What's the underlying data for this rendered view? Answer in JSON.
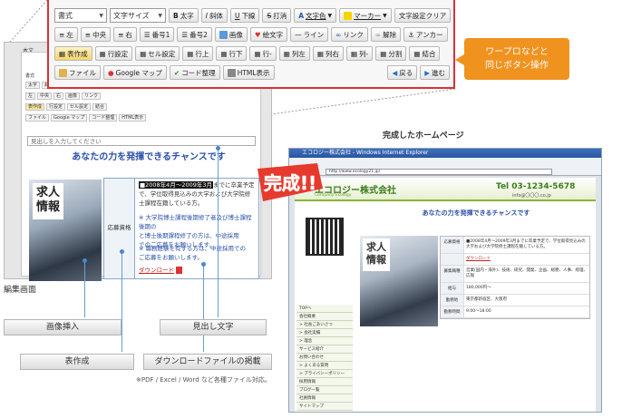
{
  "toolbar": {
    "row1": {
      "style_select": "書式",
      "fontsize_select": "文字サイズ",
      "bold": "太字",
      "italic": "斜体",
      "underline": "下線",
      "strike": "打消",
      "text_color": "文字色",
      "marker": "マーカー",
      "clear_format": "文字設定クリア"
    },
    "row2": {
      "align_left": "左",
      "align_center": "中央",
      "align_right": "右",
      "numbered": "番号1",
      "numbered2": "番号2",
      "image": "画像",
      "emoji": "絵文字",
      "line": "ライン",
      "link": "リンク",
      "unlink": "解除",
      "anchor": "アンカー"
    },
    "row3": {
      "table": "表作成",
      "row_setting": "行設定",
      "cell_setting": "セル設定",
      "row_add": "行上",
      "row_down": "行下",
      "row_del": "行-",
      "col_left": "列左",
      "col_right": "列右",
      "col_del": "列-",
      "split": "分割",
      "merge": "結合"
    },
    "row4": {
      "file": "ファイル",
      "google_map": "Google マップ",
      "code": "コード整理",
      "html": "HTML表示",
      "back": "戻る",
      "forward": "進む"
    }
  },
  "callout": {
    "line1": "ワープロなどと",
    "line2": "同じボタン操作"
  },
  "editor": {
    "tab_label": "本文",
    "tab_sub": "書式",
    "heading_input": "見出しを入力してください",
    "title": "あなたの力を発揮できるチャンスです",
    "image_text": "求人\n情報",
    "table_label": "応募資格",
    "cell_line1_hl": "■2008年4月〜2009年3月",
    "cell_line1": "までに卒業予定",
    "cell_line2": "で、学位取得見込みの大学および大学院修",
    "cell_line3": "士課程在籍している方。",
    "note1": "※ 大学院博士課程後期修了者及び博士課程後期の",
    "note1b": "と博士後期課程修了の方は、中途採用",
    "note1c": "でのご応募をお願いします。",
    "note2": "※ 職務経験を有する方は、中途採用での",
    "note2b": "ご応募をお願いします。",
    "download": "ダウンロード"
  },
  "site": {
    "caption": "完成したホームページ",
    "window_title": "エコロジー株式会社 - Windows Internet Explorer",
    "address": "http://www.ecology21.jp/",
    "company": "エコロジー株式会社",
    "company_en": "Company Ecology",
    "tel": "Tel 03-1234-5678",
    "mail": "info@〇〇〇.co.jp",
    "title": "あなたの力を発揮できるチャンスです",
    "image_text": "求人\n情報",
    "nav": [
      "TOPへ",
      "会社概要",
      "> 社長ごあいさつ",
      "> 会社実績",
      "> 理念",
      "サービス紹介",
      "お問い合わせ",
      "> よくある質問",
      "> プライバシーポリシー",
      "採用情報",
      "ブログ一覧",
      "社員情報",
      "サイトマップ"
    ],
    "rows": [
      {
        "k": "応募資格",
        "v": "■2008年4月〜2009年3月までに卒業予定で、学位取得見込みの大学および大学院修士課程在籍している方。"
      },
      {
        "k": "",
        "v": "ダウンロード"
      },
      {
        "k": "募集職種",
        "v": "営業(国内・海外)、技術、研究、開発、企画、総務、人事、経理、広報"
      },
      {
        "k": "給与",
        "v": "180,000円〜"
      },
      {
        "k": "勤務地",
        "v": "東京都新宿区、大阪府"
      },
      {
        "k": "勤務時間",
        "v": "9:00〜18:00"
      }
    ]
  },
  "badge": "完成!!",
  "labels": {
    "edit_screen": "編集画面",
    "image_insert": "画像挿入",
    "heading_text": "見出し文字",
    "table_create": "表作成",
    "download_file": "ダウンロードファイルの掲載",
    "note": "※PDF / Excel / Word など各種ファイル対応。"
  },
  "colors": {
    "accent_red": "#d9303a",
    "callout_orange": "#f0921e",
    "title_blue": "#2a4fa8",
    "line_blue": "#6b9dd6"
  }
}
